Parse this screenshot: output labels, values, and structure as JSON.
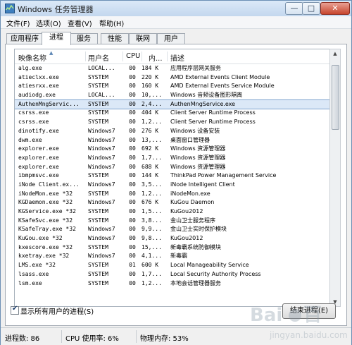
{
  "window": {
    "title": "Windows 任务管理器"
  },
  "title_buttons": {
    "minimize": "—",
    "maximize": "□",
    "close": "✕"
  },
  "menu": [
    "文件(F)",
    "选项(O)",
    "查看(V)",
    "帮助(H)"
  ],
  "tabs": [
    "应用程序",
    "进程",
    "服务",
    "性能",
    "联网",
    "用户"
  ],
  "active_tab": "进程",
  "columns": [
    "映像名称",
    "用户名",
    "CPU",
    "内...",
    "描述"
  ],
  "processes": [
    {
      "name": "alg.exe",
      "user": "LOCAL...",
      "cpu": "00",
      "mem": "184 K",
      "desc": "应用程序层网关服务"
    },
    {
      "name": "atieclxx.exe",
      "user": "SYSTEM",
      "cpu": "00",
      "mem": "220 K",
      "desc": "AMD External Events Client Module"
    },
    {
      "name": "atiesrxx.exe",
      "user": "SYSTEM",
      "cpu": "00",
      "mem": "160 K",
      "desc": "AMD External Events Service Module"
    },
    {
      "name": "audiodg.exe",
      "user": "LOCAL...",
      "cpu": "00",
      "mem": "10,...",
      "desc": "Windows 音频设备图形隔离"
    },
    {
      "name": "AuthenMngServic...",
      "user": "SYSTEM",
      "cpu": "00",
      "mem": "2,4...",
      "desc": "AuthenMngService.exe",
      "selected": true
    },
    {
      "name": "csrss.exe",
      "user": "SYSTEM",
      "cpu": "00",
      "mem": "404 K",
      "desc": "Client Server Runtime Process"
    },
    {
      "name": "csrss.exe",
      "user": "SYSTEM",
      "cpu": "00",
      "mem": "1,2...",
      "desc": "Client Server Runtime Process"
    },
    {
      "name": "dinotify.exe",
      "user": "Windows7",
      "cpu": "00",
      "mem": "276 K",
      "desc": "Windows 设备安装"
    },
    {
      "name": "dwm.exe",
      "user": "Windows7",
      "cpu": "00",
      "mem": "13,...",
      "desc": "桌面窗口管理器"
    },
    {
      "name": "explorer.exe",
      "user": "Windows7",
      "cpu": "00",
      "mem": "692 K",
      "desc": "Windows 资源管理器"
    },
    {
      "name": "explorer.exe",
      "user": "Windows7",
      "cpu": "00",
      "mem": "1,7...",
      "desc": "Windows 资源管理器"
    },
    {
      "name": "explorer.exe",
      "user": "Windows7",
      "cpu": "00",
      "mem": "688 K",
      "desc": "Windows 资源管理器"
    },
    {
      "name": "ibmpmsvc.exe",
      "user": "SYSTEM",
      "cpu": "00",
      "mem": "144 K",
      "desc": "ThinkPad Power Management Service"
    },
    {
      "name": "iNode Client.ex...",
      "user": "Windows7",
      "cpu": "00",
      "mem": "3,5...",
      "desc": "iNode Intelligent Client"
    },
    {
      "name": "iNodeMon.exe *32",
      "user": "SYSTEM",
      "cpu": "00",
      "mem": "1,2...",
      "desc": "iNodeMon.exe"
    },
    {
      "name": "KGDaemon.exe *32",
      "user": "Windows7",
      "cpu": "00",
      "mem": "676 K",
      "desc": "KuGou Daemon"
    },
    {
      "name": "KGService.exe *32",
      "user": "SYSTEM",
      "cpu": "00",
      "mem": "1,5...",
      "desc": "KuGou2012"
    },
    {
      "name": "KSafeSvc.exe *32",
      "user": "SYSTEM",
      "cpu": "00",
      "mem": "3,8...",
      "desc": "金山卫士服务程序"
    },
    {
      "name": "KSafeTray.exe *32",
      "user": "Windows7",
      "cpu": "00",
      "mem": "9,9...",
      "desc": "金山卫士实时保护模块"
    },
    {
      "name": "KuGou.exe *32",
      "user": "Windows7",
      "cpu": "00",
      "mem": "9,8...",
      "desc": "KuGou2012"
    },
    {
      "name": "kxescore.exe *32",
      "user": "SYSTEM",
      "cpu": "00",
      "mem": "15,...",
      "desc": "新毒霸系统防御模块"
    },
    {
      "name": "kxetray.exe *32",
      "user": "Windows7",
      "cpu": "00",
      "mem": "4,1...",
      "desc": "新毒霸"
    },
    {
      "name": "LMS.exe *32",
      "user": "SYSTEM",
      "cpu": "01",
      "mem": "600 K",
      "desc": "Local Manageability Service"
    },
    {
      "name": "lsass.exe",
      "user": "SYSTEM",
      "cpu": "00",
      "mem": "1,7...",
      "desc": "Local Security Authority Process"
    },
    {
      "name": "lsm.exe",
      "user": "SYSTEM",
      "cpu": "00",
      "mem": "1,2...",
      "desc": "本地会话管理器服务"
    }
  ],
  "show_all_users": {
    "label": "显示所有用户的进程(S)",
    "checked": true
  },
  "end_process_button": "结束进程(E)",
  "status": {
    "processes": "进程数: 86",
    "cpu": "CPU 使用率: 6%",
    "memory": "物理内存: 53%"
  },
  "watermark": "Baidu 经验"
}
